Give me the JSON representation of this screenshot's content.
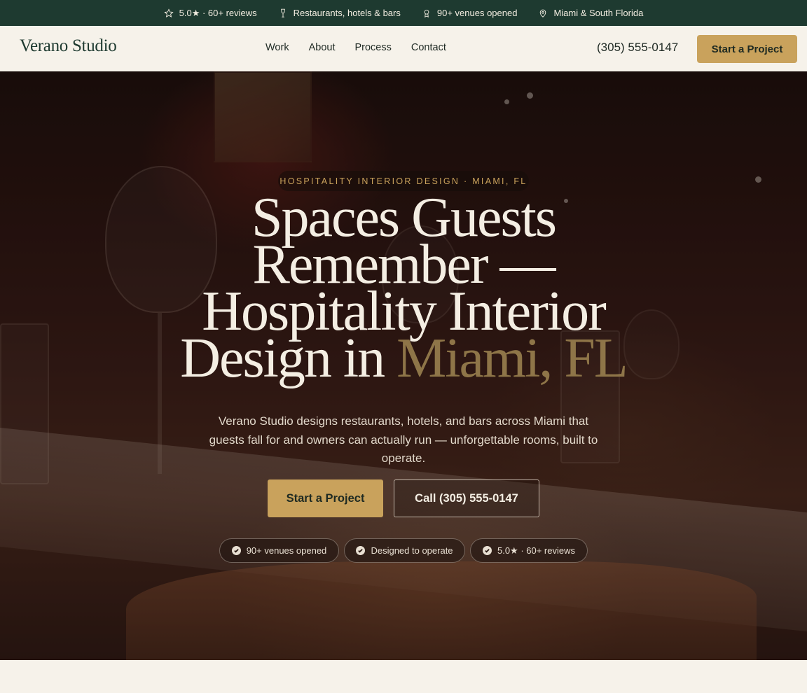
{
  "topbar": {
    "items": [
      {
        "icon": "star-icon",
        "text": "5.0★ · 60+ reviews"
      },
      {
        "icon": "wine-glass-icon",
        "text": "Restaurants, hotels & bars"
      },
      {
        "icon": "award-icon",
        "text": "90+ venues opened"
      },
      {
        "icon": "map-pin-icon",
        "text": "Miami & South Florida"
      }
    ]
  },
  "header": {
    "logo": "Verano Studio",
    "nav": [
      "Work",
      "About",
      "Process",
      "Contact"
    ],
    "phone": "(305) 555-0147",
    "cta": "Start a Project"
  },
  "hero": {
    "eyebrow": "HOSPITALITY INTERIOR DESIGN · MIAMI, FL",
    "headline_main": "Spaces Guests Remember — Hospitality Interior Design in ",
    "headline_accent": "Miami, FL",
    "subtitle": "Verano Studio designs restaurants, hotels, and bars across Miami that guests fall for and owners can actually run — unforgettable rooms, built to operate.",
    "primary_cta": "Start a Project",
    "secondary_cta": "Call (305) 555-0147",
    "badges": [
      "90+ venues opened",
      "Designed to operate",
      "5.0★ · 60+ reviews"
    ]
  },
  "colors": {
    "topbar_bg": "#1e3a30",
    "accent_gold": "#c9a25c",
    "headline_accent": "#8e7548",
    "page_bg": "#f6f2ea"
  }
}
